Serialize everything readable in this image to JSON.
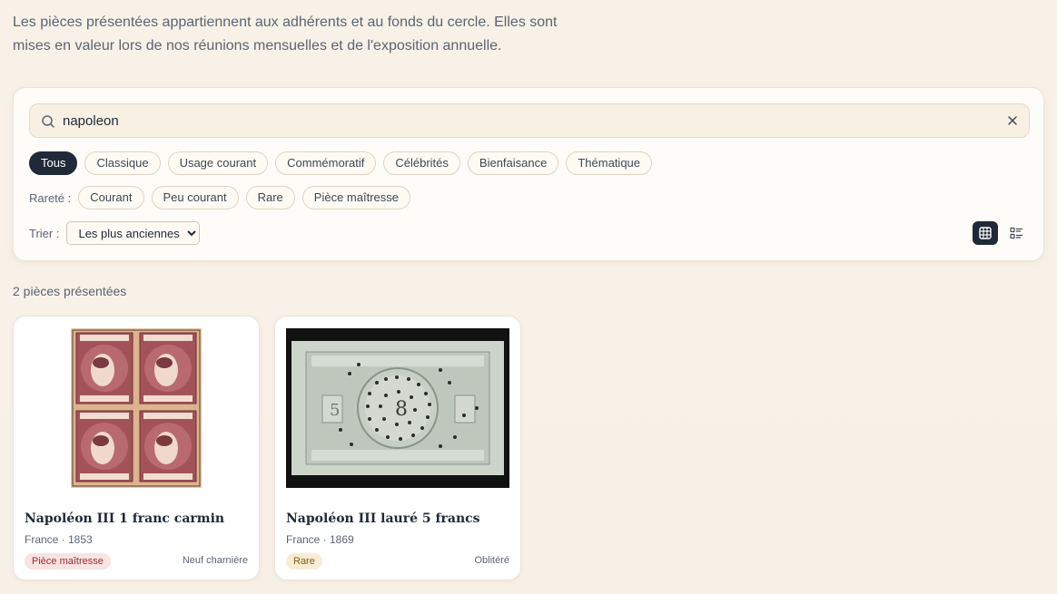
{
  "intro": {
    "line1": "Les pièces présentées appartiennent aux adhérents et au fonds du cercle. Elles sont",
    "line2": "mises en valeur lors de nos réunions mensuelles et de l'exposition annuelle."
  },
  "search": {
    "value": "napoleon",
    "icon": "search-icon",
    "clear_icon": "close-icon"
  },
  "categories": [
    {
      "label": "Tous",
      "active": true
    },
    {
      "label": "Classique",
      "active": false
    },
    {
      "label": "Usage courant",
      "active": false
    },
    {
      "label": "Commémoratif",
      "active": false
    },
    {
      "label": "Célébrités",
      "active": false
    },
    {
      "label": "Bienfaisance",
      "active": false
    },
    {
      "label": "Thématique",
      "active": false
    }
  ],
  "rarity": {
    "label": "Rareté :",
    "options": [
      "Courant",
      "Peu courant",
      "Rare",
      "Pièce maîtresse"
    ]
  },
  "sort": {
    "label": "Trier :",
    "selected": "Les plus anciennes"
  },
  "view": {
    "grid_icon": "grid-icon",
    "list_icon": "list-icon",
    "active": "grid"
  },
  "results": {
    "count_label": "2 pièces présentées"
  },
  "cards": [
    {
      "title": "Napoléon III 1 franc carmin",
      "meta": "France · 1853",
      "badge": "Pièce maîtresse",
      "condition": "Neuf charnière",
      "image": "stamp-block-carmine"
    },
    {
      "title": "Napoléon III lauré 5 francs",
      "meta": "France · 1869",
      "badge": "Rare",
      "condition": "Oblitéré",
      "image": "stamp-grey-empire"
    }
  ],
  "colors": {
    "accent_dark": "#1f2937",
    "badge_master_bg": "#f9e3e3",
    "badge_rare_bg": "#f8ecd4",
    "stamp_carmine": "#9a4a4e",
    "stamp_grey": "#c3cbc1"
  }
}
